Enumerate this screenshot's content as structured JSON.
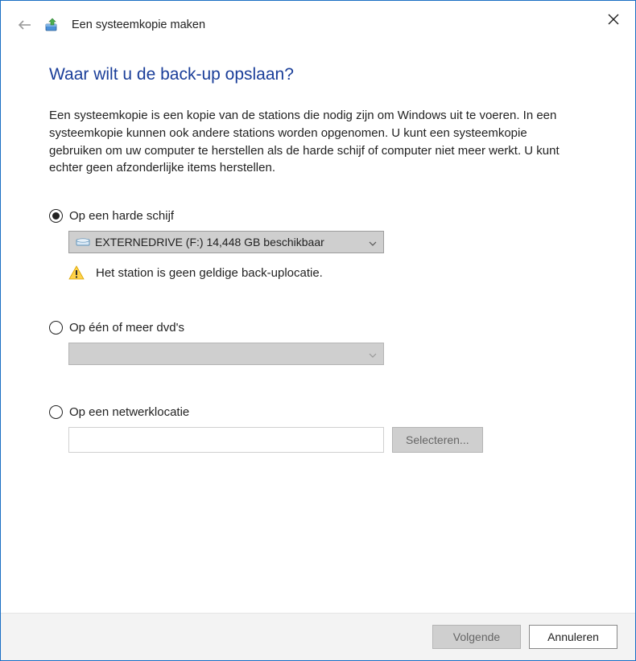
{
  "header": {
    "title": "Een systeemkopie maken"
  },
  "page": {
    "heading": "Waar wilt u de back-up opslaan?",
    "description": "Een systeemkopie is een kopie van de stations die nodig zijn om Windows uit te voeren. In een systeemkopie kunnen ook andere stations worden opgenomen. U kunt een systeemkopie gebruiken om uw computer te herstellen als de harde schijf of computer niet meer werkt. U kunt echter geen afzonderlijke items herstellen."
  },
  "options": {
    "hard_disk": {
      "label": "Op een harde schijf",
      "selected_value": "EXTERNEDRIVE (F:)  14,448 GB beschikbaar",
      "warning": "Het station is geen geldige back-uplocatie."
    },
    "dvd": {
      "label": "Op één of meer dvd's"
    },
    "network": {
      "label": "Op een netwerklocatie",
      "browse_label": "Selecteren..."
    }
  },
  "footer": {
    "next": "Volgende",
    "cancel": "Annuleren"
  }
}
